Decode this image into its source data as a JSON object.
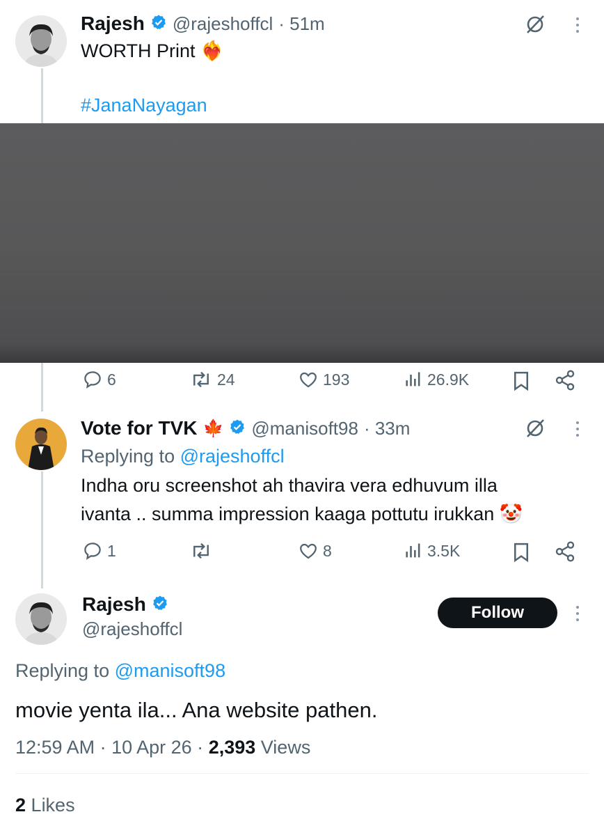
{
  "tweet1": {
    "name": "Rajesh",
    "handle": "@rajeshoffcl",
    "time": "· 51m",
    "line1": "WORTH Print",
    "emoji": "❤️‍🔥",
    "hashtag": "#JanaNayagan",
    "actions": {
      "replies": "6",
      "retweets": "24",
      "likes": "193",
      "views": "26.9K"
    }
  },
  "tweet2": {
    "name": "Vote for TVK",
    "name_emoji": "🍁",
    "handle": "@manisoft98",
    "time": "· 33m",
    "replying_prefix": "Replying to",
    "replying_to": "@rajeshoffcl",
    "line1": "Indha oru screenshot ah thavira vera edhuvum illa",
    "line2": "ivanta .. summa impression kaaga pottutu irukkan",
    "emoji": "🤡",
    "actions": {
      "replies": "1",
      "retweets": "",
      "likes": "8",
      "views": "3.5K"
    }
  },
  "tweet3": {
    "name": "Rajesh",
    "handle": "@rajeshoffcl",
    "follow_label": "Follow",
    "replying_prefix": "Replying to",
    "replying_to": "@manisoft98",
    "text": "movie yenta ila... Ana website pathen.",
    "timestamp": "12:59 AM · 10 Apr 26 ·",
    "views_count": "2,393",
    "views_label": "Views",
    "likes_count": "2",
    "likes_label": "Likes"
  },
  "colors": {
    "accent": "#1d9bf0",
    "text": "#0f1419",
    "muted": "#536471",
    "divider": "#eff3f4"
  }
}
